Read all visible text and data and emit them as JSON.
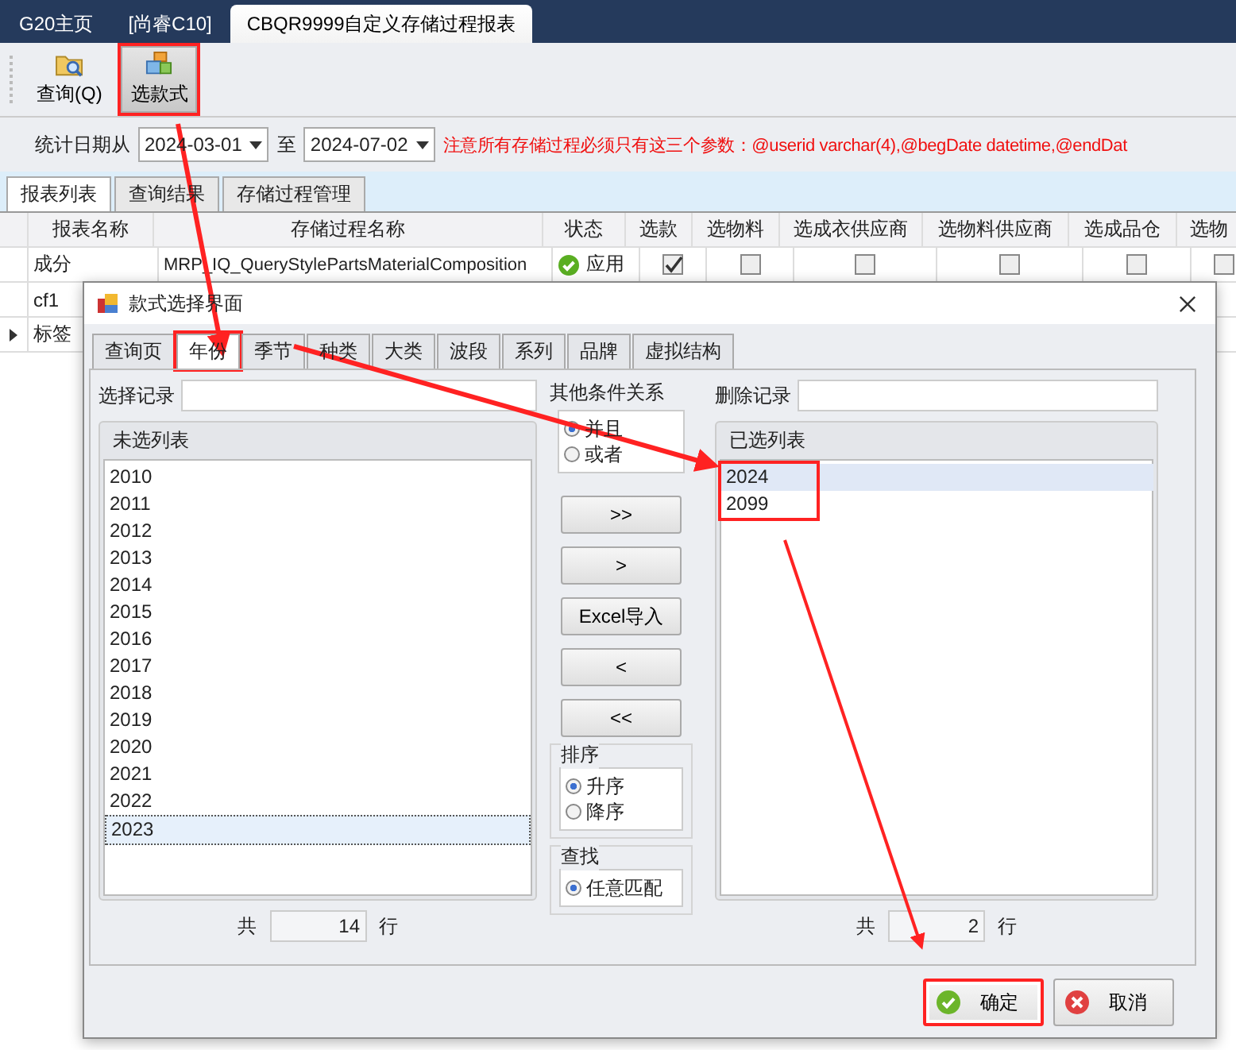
{
  "app_tabs": [
    {
      "label": "G20主页",
      "selected": false
    },
    {
      "label": "[尚睿C10]",
      "selected": false
    },
    {
      "label": "CBQR9999自定义存储过程报表",
      "selected": true
    }
  ],
  "toolbar": [
    {
      "label": "查询(Q)",
      "kind": "query",
      "pressed": false,
      "highlighted": false
    },
    {
      "label": "选款式",
      "kind": "style",
      "pressed": true,
      "highlighted": true
    }
  ],
  "filter": {
    "label": "统计日期从",
    "from": "2024-03-01",
    "sep": "至",
    "to": "2024-07-02",
    "note": "注意所有存储过程必须只有这三个参数：@userid varchar(4),@begDate datetime,@endDat"
  },
  "subtabs": [
    {
      "label": "报表列表",
      "selected": true
    },
    {
      "label": "查询结果",
      "selected": false
    },
    {
      "label": "存储过程管理",
      "selected": false
    }
  ],
  "grid": {
    "columns": [
      "报表名称",
      "存储过程名称",
      "状态",
      "选款",
      "选物料",
      "选成衣供应商",
      "选物料供应商",
      "选成品仓",
      "选物"
    ],
    "rows": [
      {
        "name": "成分",
        "procedure": "MRP_IQ_QueryStylePartsMaterialComposition",
        "status": "应用",
        "checks": [
          true,
          false,
          false,
          false,
          false,
          false
        ],
        "current": false
      },
      {
        "name": "cf1",
        "current": false
      },
      {
        "name": "标签",
        "current": true
      }
    ]
  },
  "dialog": {
    "title": "款式选择界面",
    "tabs": [
      {
        "label": "查询页",
        "selected": false,
        "highlighted": false
      },
      {
        "label": "年份",
        "selected": true,
        "highlighted": true
      },
      {
        "label": "季节",
        "selected": false,
        "highlighted": false
      },
      {
        "label": "种类",
        "selected": false,
        "highlighted": false
      },
      {
        "label": "大类",
        "selected": false,
        "highlighted": false
      },
      {
        "label": "波段",
        "selected": false,
        "highlighted": false
      },
      {
        "label": "系列",
        "selected": false,
        "highlighted": false
      },
      {
        "label": "品牌",
        "selected": false,
        "highlighted": false
      },
      {
        "label": "虚拟结构",
        "selected": false,
        "highlighted": false
      }
    ],
    "available": {
      "filter_label": "选择记录",
      "title": "未选列表",
      "highlighted": false,
      "count_label": "共",
      "count": "14",
      "unit": "行",
      "items": [
        {
          "label": "2010",
          "selected": false
        },
        {
          "label": "2011",
          "selected": false
        },
        {
          "label": "2012",
          "selected": false
        },
        {
          "label": "2013",
          "selected": false
        },
        {
          "label": "2014",
          "selected": false
        },
        {
          "label": "2015",
          "selected": false
        },
        {
          "label": "2016",
          "selected": false
        },
        {
          "label": "2017",
          "selected": false
        },
        {
          "label": "2018",
          "selected": false
        },
        {
          "label": "2019",
          "selected": false
        },
        {
          "label": "2020",
          "selected": false
        },
        {
          "label": "2021",
          "selected": false
        },
        {
          "label": "2022",
          "selected": false
        },
        {
          "label": "2023",
          "selected": true
        }
      ]
    },
    "relation": {
      "title": "其他条件关系",
      "options": [
        {
          "label": "并且",
          "selected": true
        },
        {
          "label": "或者",
          "selected": false
        }
      ]
    },
    "move_buttons": [
      ">>",
      ">",
      "Excel导入",
      "<",
      "<<"
    ],
    "sort": {
      "title": "排序",
      "options": [
        {
          "label": "升序",
          "selected": true
        },
        {
          "label": "降序",
          "selected": false
        }
      ]
    },
    "find": {
      "title": "查找",
      "options": [
        {
          "label": "任意匹配",
          "selected": true
        }
      ]
    },
    "chosen": {
      "filter_label": "删除记录",
      "title": "已选列表",
      "highlighted": true,
      "count_label": "共",
      "count": "2",
      "unit": "行",
      "items": [
        {
          "label": "2024",
          "selected": true
        },
        {
          "label": "2099",
          "selected": false
        }
      ]
    },
    "actions": [
      {
        "label": "确定",
        "kind": "ok",
        "highlighted": true
      },
      {
        "label": "取消",
        "kind": "cancel",
        "highlighted": false
      }
    ]
  }
}
